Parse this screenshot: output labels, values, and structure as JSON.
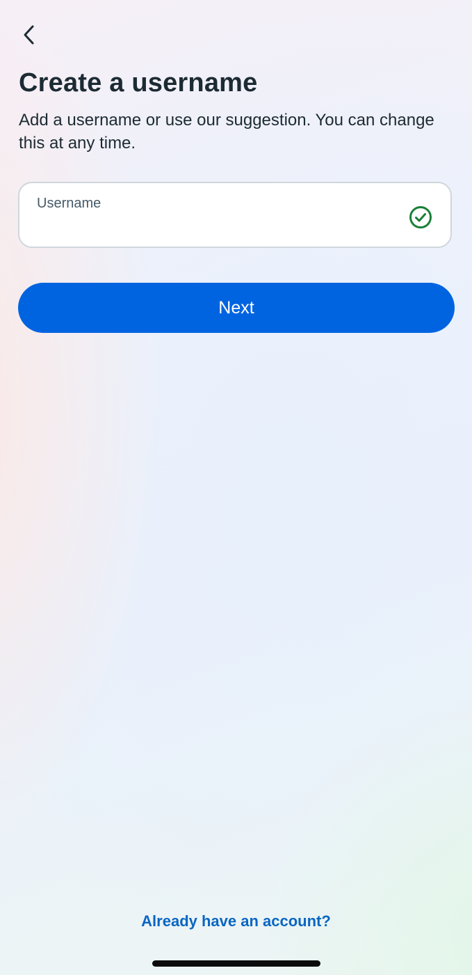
{
  "header": {
    "back_icon": "chevron-left-icon",
    "title": "Create a username",
    "subtitle": "Add a username or use our suggestion. You can change this at any time."
  },
  "username_field": {
    "label": "Username",
    "value": "",
    "status_icon": "check-circle-icon",
    "status_color": "#1a7f37"
  },
  "actions": {
    "next_label": "Next",
    "next_color": "#0064e0",
    "login_link": "Already have an account?",
    "link_color": "#0a66c2"
  }
}
